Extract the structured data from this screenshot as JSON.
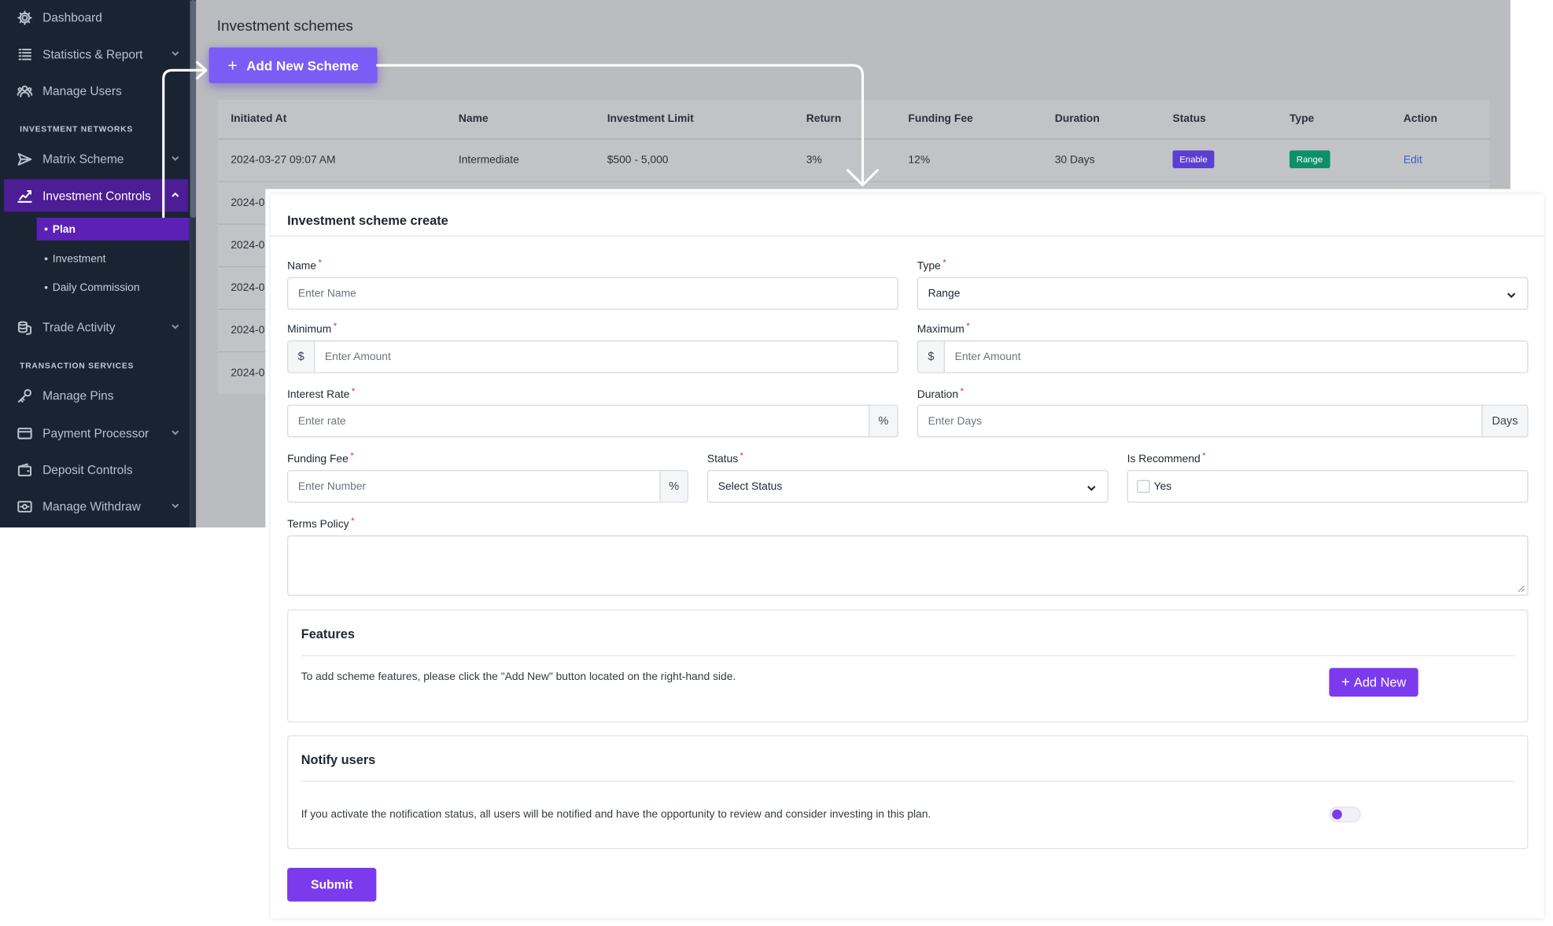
{
  "sidebar": {
    "items": [
      {
        "label": "Dashboard",
        "icon": "gear-icon"
      },
      {
        "label": "Statistics & Report",
        "icon": "list-icon"
      },
      {
        "label": "Manage Users",
        "icon": "users-icon"
      },
      {
        "label": "Matrix Scheme",
        "icon": "send-icon"
      },
      {
        "label": "Investment Controls",
        "icon": "chart-icon"
      },
      {
        "label": "Trade Activity",
        "icon": "coins-icon"
      },
      {
        "label": "Manage Pins",
        "icon": "key-icon"
      },
      {
        "label": "Payment Processor",
        "icon": "card-icon"
      },
      {
        "label": "Deposit Controls",
        "icon": "wallet-icon"
      },
      {
        "label": "Manage Withdraw",
        "icon": "withdraw-icon"
      }
    ],
    "sections": [
      "INVESTMENT NETWORKS",
      "TRANSACTION SERVICES"
    ],
    "subitems": [
      "Plan",
      "Investment",
      "Daily Commission"
    ],
    "accent_color": "#4c1d95"
  },
  "main": {
    "title": "Investment schemes",
    "add_button": "Add New Scheme",
    "columns": [
      "Initiated At",
      "Name",
      "Investment Limit",
      "Return",
      "Funding Fee",
      "Duration",
      "Status",
      "Type",
      "Action"
    ],
    "row": {
      "initiated_at": "2024-03-27 09:07 AM",
      "name": "Intermediate",
      "limit": "$500 - 5,000",
      "return": "3%",
      "fee": "12%",
      "duration": "30 Days",
      "status": "Enable",
      "type": "Range",
      "action": "Edit"
    },
    "partial_rows": [
      "2024-0",
      "2024-0",
      "2024-0",
      "2024-0",
      "2024-0"
    ]
  },
  "modal": {
    "title": "Investment scheme create",
    "name_label": "Name",
    "name_placeholder": "Enter Name",
    "type_label": "Type",
    "type_value": "Range",
    "minimum_label": "Minimum",
    "maximum_label": "Maximum",
    "currency": "$",
    "amount_placeholder": "Enter Amount",
    "interest_label": "Interest Rate",
    "interest_placeholder": "Enter rate",
    "percent": "%",
    "duration_label": "Duration",
    "duration_placeholder": "Enter Days",
    "days": "Days",
    "fee_label": "Funding Fee",
    "fee_placeholder": "Enter Number",
    "status_label": "Status",
    "status_value": "Select Status",
    "recommend_label": "Is Recommend",
    "recommend_option": "Yes",
    "terms_label": "Terms Policy",
    "required_mark": "*",
    "features_title": "Features",
    "features_text": "To add scheme features, please click the \"Add New\" button located on the right-hand side.",
    "add_new": "Add New",
    "notify_title": "Notify users",
    "notify_text": "If you activate the notification status, all users will be notified and have the opportunity to review and consider investing in this plan.",
    "submit": "Submit"
  },
  "colors": {
    "primary": "#7c3aed",
    "button_primary": "#7b5cf5",
    "enable_badge": "#5b3fd1",
    "range_badge": "#0d8f6a",
    "required": "#e11d48"
  }
}
